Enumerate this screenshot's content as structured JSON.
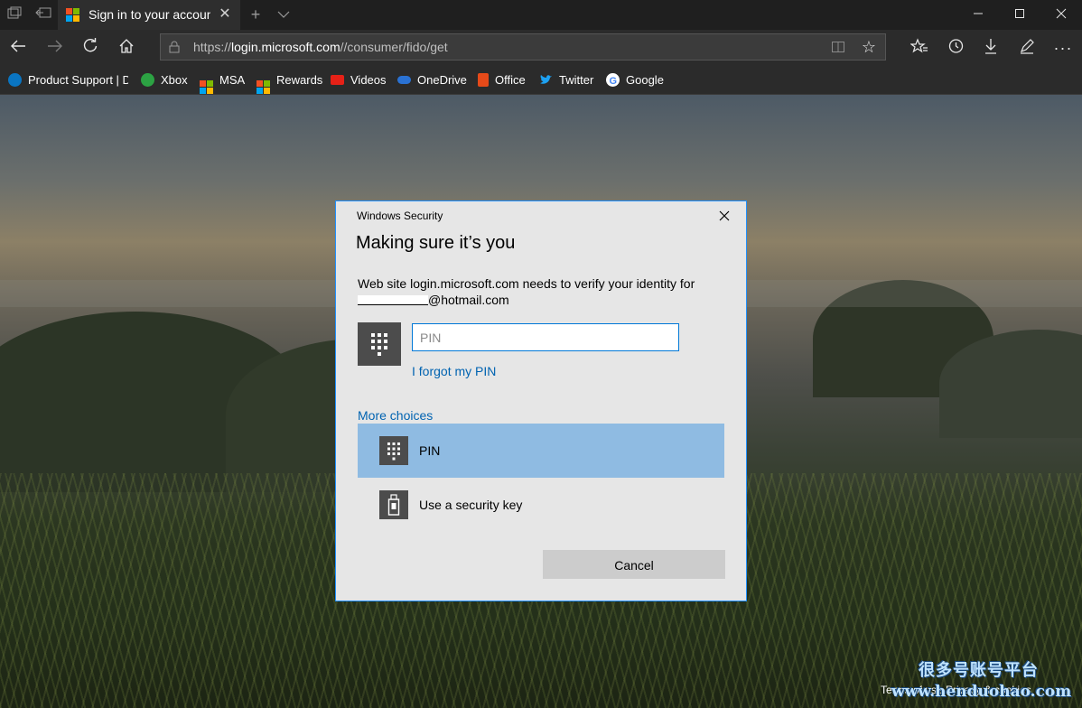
{
  "browser": {
    "tab": {
      "title": "Sign in to your accoun"
    },
    "address": {
      "prefix": "https://",
      "domain": "login.microsoft.com",
      "path": "//consumer/fido/get"
    },
    "favorites": [
      {
        "label": "Product Support | De",
        "icon_color": "#0a75c2"
      },
      {
        "label": "Xbox",
        "icon_color": "#2ca243"
      },
      {
        "label": "MSA",
        "icon_color": "#f25022"
      },
      {
        "label": "Rewards",
        "icon_color": "#f25022"
      },
      {
        "label": "Videos",
        "icon_color": "#e62117"
      },
      {
        "label": "OneDrive",
        "icon_color": "#2a72d4"
      },
      {
        "label": "Office",
        "icon_color": "#e64a19"
      },
      {
        "label": "Twitter",
        "icon_color": "#1da1f2"
      },
      {
        "label": "Google",
        "icon_color": "#ffffff"
      }
    ]
  },
  "dialog": {
    "source": "Windows Security",
    "title": "Making sure it’s you",
    "message": "Web site login.microsoft.com needs to verify your identity for",
    "account_suffix": "@hotmail.com",
    "pin_placeholder": "PIN",
    "forgot_pin": "I forgot my PIN",
    "more_choices": "More choices",
    "options": [
      {
        "label": "PIN",
        "selected": true,
        "icon": "keypad-icon"
      },
      {
        "label": "Use a security key",
        "selected": false,
        "icon": "usb-key-icon"
      }
    ],
    "cancel": "Cancel"
  },
  "page": {
    "footer": "Terms of use     Privacy & cookies",
    "watermark_line1": "很多号账号平台",
    "watermark_line2": "www.henduohao.com"
  },
  "colors": {
    "accent": "#0078d7",
    "link": "#0063b1",
    "selected_option": "#8fbbe2"
  }
}
